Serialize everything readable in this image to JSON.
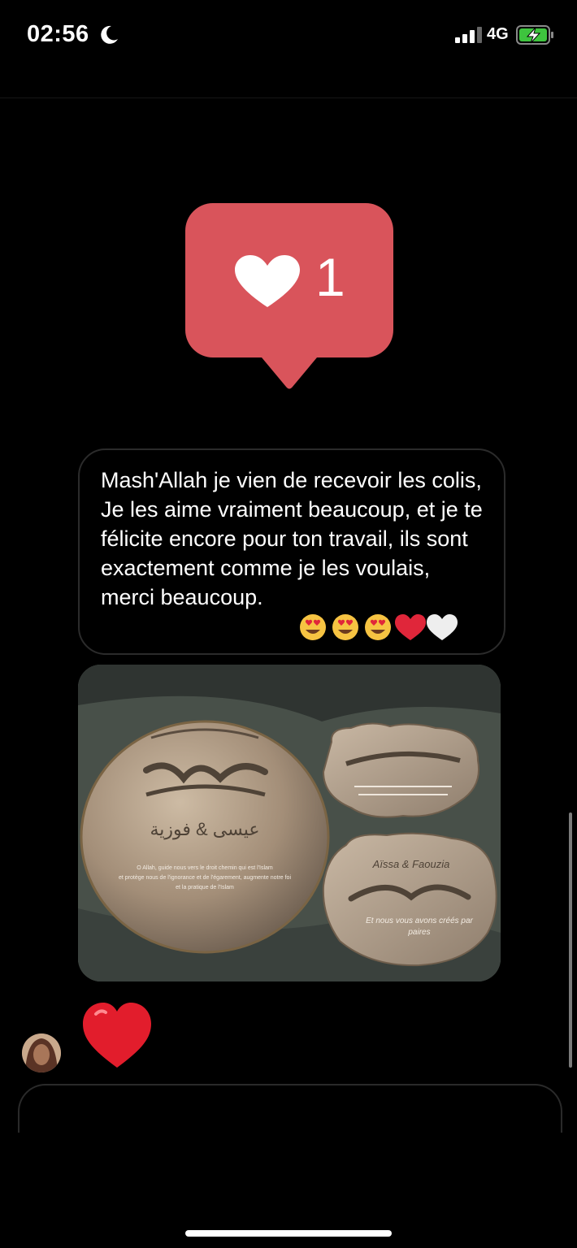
{
  "status_bar": {
    "time": "02:56",
    "network": "4G",
    "icons": [
      "moon-icon",
      "signal-icon",
      "battery-charging-icon"
    ]
  },
  "notification": {
    "icon": "heart-icon",
    "count": "1",
    "color": "#d9545b"
  },
  "message": {
    "text": "Mash'Allah je vien de recevoir les colis,  Je les aime vraiment beaucoup, et je te félicite encore pour ton travail, ils sont exactement comme je les voulais, merci beaucoup.",
    "emojis": [
      "heart-eyes-emoji",
      "heart-eyes-emoji",
      "heart-eyes-emoji",
      "red-heart-emoji",
      "white-heart-emoji"
    ]
  },
  "photo": {
    "round_plaque": {
      "names": "عيسى & فوزية",
      "caption_line1": "O Allah, guide nous vers le droit chemin qui est l'Islam",
      "caption_line2": "et protège nous de l'ignorance et de l'égarement, augmente notre foi",
      "caption_line3": "et la pratique de l'Islam"
    },
    "bottom_plaque": {
      "names": "Aïssa & Faouzia",
      "caption_line1": "Et nous vous avons créés par",
      "caption_line2": "paires"
    }
  },
  "reaction": {
    "icon": "red-heart-emoji"
  },
  "colors": {
    "background": "#000000",
    "bubble_border": "#2b2b2b",
    "accent_red": "#d9545b"
  }
}
